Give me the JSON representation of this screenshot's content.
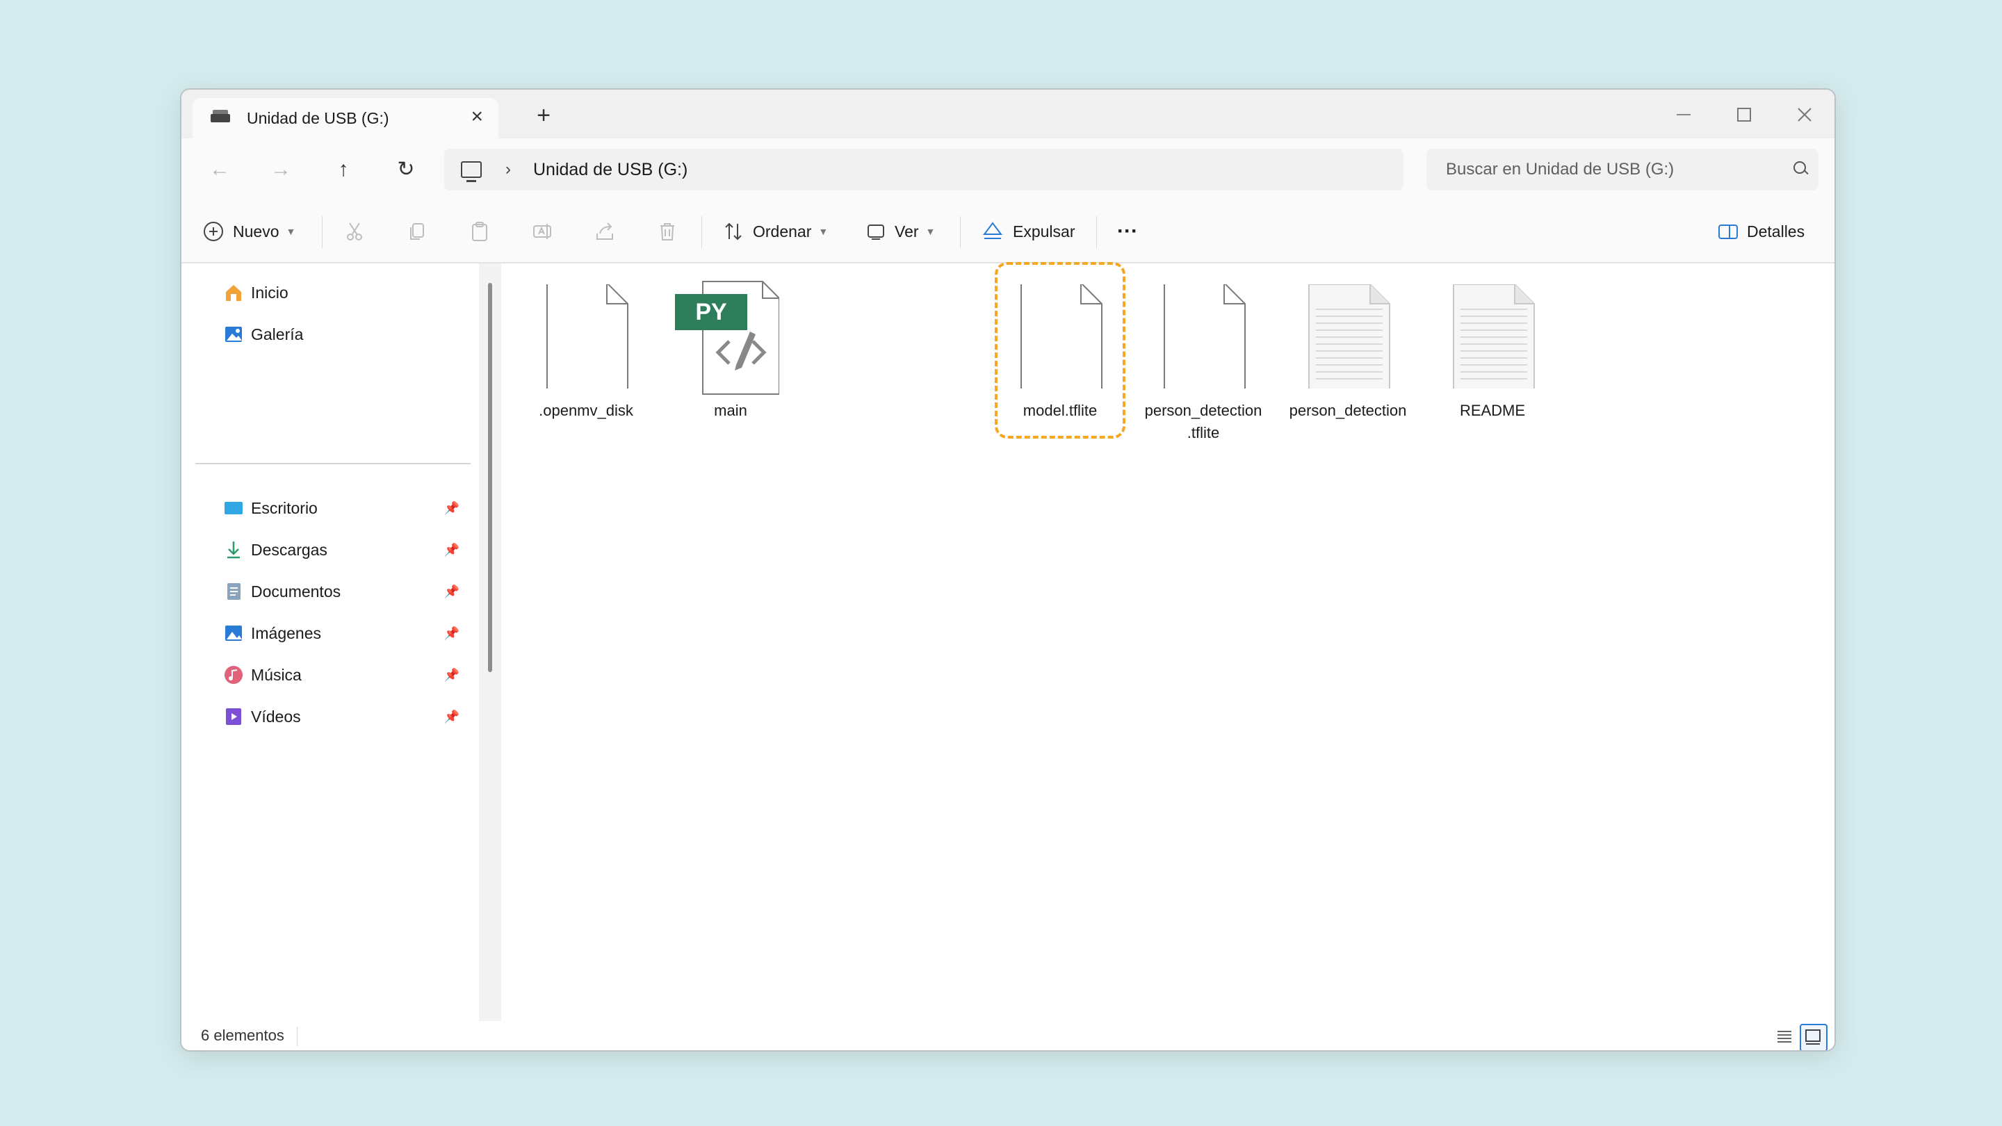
{
  "window": {
    "tab_title": "Unidad de USB (G:)",
    "new_tab_symbol": "+",
    "close_symbol": "×"
  },
  "nav": {
    "back_symbol": "←",
    "forward_symbol": "→",
    "up_symbol": "↑",
    "refresh_symbol": "↻",
    "breadcrumb_separator": "›",
    "breadcrumb": "Unidad de USB (G:)",
    "search_placeholder": "Buscar en Unidad de USB (G:)"
  },
  "toolbar": {
    "new_label": "Nuevo",
    "sort_label": "Ordenar",
    "view_label": "Ver",
    "eject_label": "Expulsar",
    "more_symbol": "···",
    "details_label": "Detalles"
  },
  "sidebar": {
    "quick": [
      {
        "label": "Inicio",
        "icon": "home-icon"
      },
      {
        "label": "Galería",
        "icon": "gallery-icon"
      }
    ],
    "pinned": [
      {
        "label": "Escritorio",
        "icon": "desktop-icon"
      },
      {
        "label": "Descargas",
        "icon": "download-icon"
      },
      {
        "label": "Documentos",
        "icon": "documents-icon"
      },
      {
        "label": "Imágenes",
        "icon": "pictures-icon"
      },
      {
        "label": "Música",
        "icon": "music-icon"
      },
      {
        "label": "Vídeos",
        "icon": "videos-icon"
      }
    ]
  },
  "files": [
    {
      "name": ".openmv_disk",
      "type": "blank"
    },
    {
      "name": "main",
      "type": "python",
      "badge": "PY"
    },
    {
      "name": "model.tflite",
      "type": "blank",
      "highlighted": true
    },
    {
      "name": "person_detection .tflite",
      "type": "blank"
    },
    {
      "name": "person_detection",
      "type": "text"
    },
    {
      "name": "README",
      "type": "text"
    }
  ],
  "status": {
    "item_count": "6 elementos"
  },
  "colors": {
    "background": "#d5ecee",
    "highlight_dashed": "#f5a623",
    "py_badge": "#2e7d5b",
    "accent": "#2a7bd6"
  }
}
